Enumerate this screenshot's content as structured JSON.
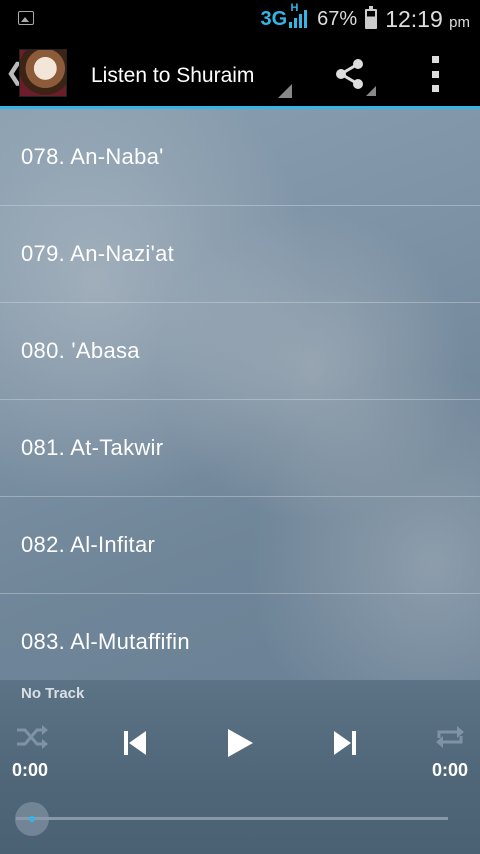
{
  "status_bar": {
    "network": "3G",
    "network_sub": "H",
    "battery_percent": "67%",
    "time": "12:19",
    "ampm": "pm",
    "colors": {
      "network": "#33b5e5"
    }
  },
  "action_bar": {
    "title": "Listen to Shuraim",
    "icons": [
      "back-chevron-icon",
      "app-avatar",
      "share-icon",
      "overflow-menu-icon"
    ]
  },
  "surah_list": [
    {
      "label": "078. An-Naba'"
    },
    {
      "label": "079. An-Nazi'at"
    },
    {
      "label": "080. 'Abasa"
    },
    {
      "label": "081. At-Takwir"
    },
    {
      "label": "082. Al-Infitar"
    },
    {
      "label": "083. Al-Mutaffifin"
    }
  ],
  "player": {
    "track_label": "No Track",
    "elapsed": "0:00",
    "duration": "0:00",
    "progress": 0,
    "colors": {
      "accent": "#33b5e5"
    }
  }
}
